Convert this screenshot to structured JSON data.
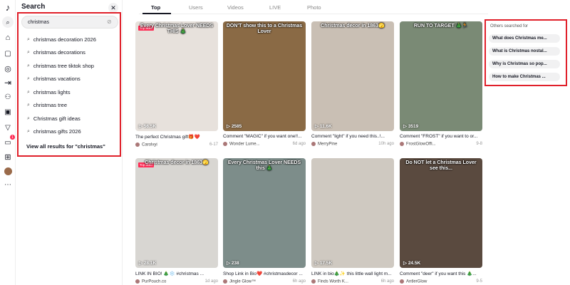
{
  "search": {
    "title": "Search",
    "query": "christmas",
    "suggestions": [
      "christmas decoration 2026",
      "christmas decorations",
      "christmas tree tiktok shop",
      "christmas vacations",
      "christmas lights",
      "christmas tree",
      "Christmas gift ideas",
      "christmas gifts 2026"
    ],
    "view_all": "View all results for \"christmas\""
  },
  "tabs": [
    "Top",
    "Users",
    "Videos",
    "LIVE",
    "Photo"
  ],
  "rail": {
    "notification_count": "1"
  },
  "videos": [
    {
      "overlay": "Every Christmas Lover NEEDS THIS 🎄",
      "top_liked": "Top liked",
      "views": "56.5K",
      "caption": "The perfect Christmas gift🎁❤️",
      "author": "Carolvyi",
      "date": "6-17",
      "bg": "#e7e1dc"
    },
    {
      "overlay": "DON'T show this to a Christmas Lover",
      "top_liked": "",
      "views": "2585",
      "caption": "Comment \"MAGIC\" if you want one!!...",
      "author": "Wonder Lume...",
      "date": "6d ago",
      "bg": "#8a6a45"
    },
    {
      "overlay": "Christmas decor in 1863🫣",
      "top_liked": "",
      "views": "11.6K",
      "caption": "Comment \"light\" if you need this..!...",
      "author": "MerryPine",
      "date": "10h ago",
      "bg": "#c9bfb4"
    },
    {
      "overlay": "RUN TO TARGET 🎄🏃",
      "top_liked": "",
      "views": "3519",
      "caption": "Comment \"FROST\" if you want to or...",
      "author": "FrostGlowOffi...",
      "date": "9-8",
      "bg": "#7a8a75"
    },
    {
      "overlay": "Christmas decor in 1863🫣",
      "top_liked": "Top liked",
      "views": "28.1K",
      "caption": "LINK IN BIO! 🎄❄️ #christmas ...",
      "author": "PurPouch.co",
      "date": "1d ago",
      "bg": "#d8d6d2"
    },
    {
      "overlay": "Every Christmas Lover NEEDS this 🎄",
      "top_liked": "",
      "views": "238",
      "caption": "Shop Link in Bio❤️ #christmasdecor ...",
      "author": "Jingle Glow™",
      "date": "6h ago",
      "bg": "#7d8d8a"
    },
    {
      "overlay": "",
      "top_liked": "",
      "views": "17.5K",
      "caption": "LINK in bio🎄✨ this little wall light m...",
      "author": "Finds Worth K...",
      "date": "6h ago",
      "bg": "#cfc9c1"
    },
    {
      "overlay": "Do NOT let a Christmas Lover see this...",
      "top_liked": "",
      "views": "24.5K",
      "caption": "Comment \"deer\" if you want this 🎄...",
      "author": "AntlerGlow",
      "date": "9-5",
      "bg": "#5a4a3f"
    }
  ],
  "others": {
    "title": "Others searched for",
    "items": [
      "What does Christmas me...",
      "What is Christmas nostal...",
      "Why is Christmas so pop...",
      "How to make Christmas ..."
    ]
  }
}
